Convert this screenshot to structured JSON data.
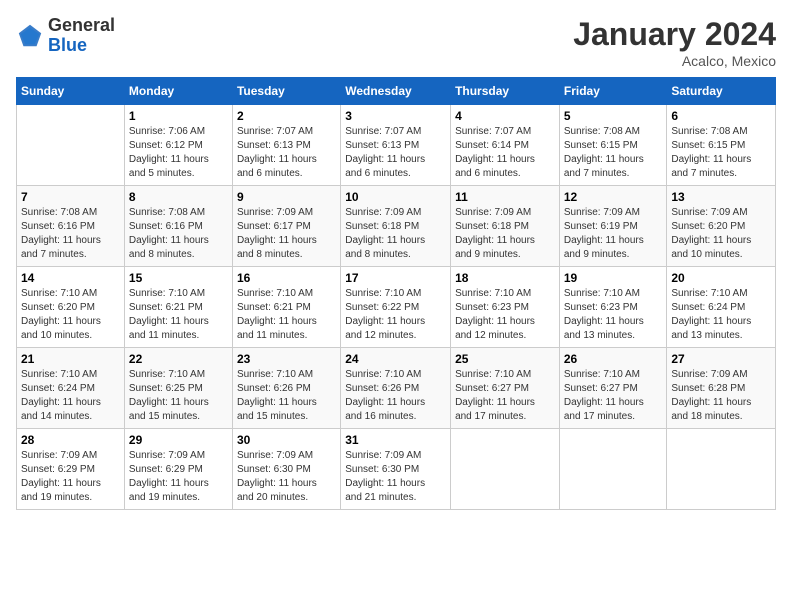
{
  "header": {
    "logo": {
      "line1": "General",
      "line2": "Blue"
    },
    "title": "January 2024",
    "location": "Acalco, Mexico"
  },
  "calendar": {
    "days_of_week": [
      "Sunday",
      "Monday",
      "Tuesday",
      "Wednesday",
      "Thursday",
      "Friday",
      "Saturday"
    ],
    "weeks": [
      [
        {
          "day": "",
          "info": ""
        },
        {
          "day": "1",
          "info": "Sunrise: 7:06 AM\nSunset: 6:12 PM\nDaylight: 11 hours\nand 5 minutes."
        },
        {
          "day": "2",
          "info": "Sunrise: 7:07 AM\nSunset: 6:13 PM\nDaylight: 11 hours\nand 6 minutes."
        },
        {
          "day": "3",
          "info": "Sunrise: 7:07 AM\nSunset: 6:13 PM\nDaylight: 11 hours\nand 6 minutes."
        },
        {
          "day": "4",
          "info": "Sunrise: 7:07 AM\nSunset: 6:14 PM\nDaylight: 11 hours\nand 6 minutes."
        },
        {
          "day": "5",
          "info": "Sunrise: 7:08 AM\nSunset: 6:15 PM\nDaylight: 11 hours\nand 7 minutes."
        },
        {
          "day": "6",
          "info": "Sunrise: 7:08 AM\nSunset: 6:15 PM\nDaylight: 11 hours\nand 7 minutes."
        }
      ],
      [
        {
          "day": "7",
          "info": "Sunrise: 7:08 AM\nSunset: 6:16 PM\nDaylight: 11 hours\nand 7 minutes."
        },
        {
          "day": "8",
          "info": "Sunrise: 7:08 AM\nSunset: 6:16 PM\nDaylight: 11 hours\nand 8 minutes."
        },
        {
          "day": "9",
          "info": "Sunrise: 7:09 AM\nSunset: 6:17 PM\nDaylight: 11 hours\nand 8 minutes."
        },
        {
          "day": "10",
          "info": "Sunrise: 7:09 AM\nSunset: 6:18 PM\nDaylight: 11 hours\nand 8 minutes."
        },
        {
          "day": "11",
          "info": "Sunrise: 7:09 AM\nSunset: 6:18 PM\nDaylight: 11 hours\nand 9 minutes."
        },
        {
          "day": "12",
          "info": "Sunrise: 7:09 AM\nSunset: 6:19 PM\nDaylight: 11 hours\nand 9 minutes."
        },
        {
          "day": "13",
          "info": "Sunrise: 7:09 AM\nSunset: 6:20 PM\nDaylight: 11 hours\nand 10 minutes."
        }
      ],
      [
        {
          "day": "14",
          "info": "Sunrise: 7:10 AM\nSunset: 6:20 PM\nDaylight: 11 hours\nand 10 minutes."
        },
        {
          "day": "15",
          "info": "Sunrise: 7:10 AM\nSunset: 6:21 PM\nDaylight: 11 hours\nand 11 minutes."
        },
        {
          "day": "16",
          "info": "Sunrise: 7:10 AM\nSunset: 6:21 PM\nDaylight: 11 hours\nand 11 minutes."
        },
        {
          "day": "17",
          "info": "Sunrise: 7:10 AM\nSunset: 6:22 PM\nDaylight: 11 hours\nand 12 minutes."
        },
        {
          "day": "18",
          "info": "Sunrise: 7:10 AM\nSunset: 6:23 PM\nDaylight: 11 hours\nand 12 minutes."
        },
        {
          "day": "19",
          "info": "Sunrise: 7:10 AM\nSunset: 6:23 PM\nDaylight: 11 hours\nand 13 minutes."
        },
        {
          "day": "20",
          "info": "Sunrise: 7:10 AM\nSunset: 6:24 PM\nDaylight: 11 hours\nand 13 minutes."
        }
      ],
      [
        {
          "day": "21",
          "info": "Sunrise: 7:10 AM\nSunset: 6:24 PM\nDaylight: 11 hours\nand 14 minutes."
        },
        {
          "day": "22",
          "info": "Sunrise: 7:10 AM\nSunset: 6:25 PM\nDaylight: 11 hours\nand 15 minutes."
        },
        {
          "day": "23",
          "info": "Sunrise: 7:10 AM\nSunset: 6:26 PM\nDaylight: 11 hours\nand 15 minutes."
        },
        {
          "day": "24",
          "info": "Sunrise: 7:10 AM\nSunset: 6:26 PM\nDaylight: 11 hours\nand 16 minutes."
        },
        {
          "day": "25",
          "info": "Sunrise: 7:10 AM\nSunset: 6:27 PM\nDaylight: 11 hours\nand 17 minutes."
        },
        {
          "day": "26",
          "info": "Sunrise: 7:10 AM\nSunset: 6:27 PM\nDaylight: 11 hours\nand 17 minutes."
        },
        {
          "day": "27",
          "info": "Sunrise: 7:09 AM\nSunset: 6:28 PM\nDaylight: 11 hours\nand 18 minutes."
        }
      ],
      [
        {
          "day": "28",
          "info": "Sunrise: 7:09 AM\nSunset: 6:29 PM\nDaylight: 11 hours\nand 19 minutes."
        },
        {
          "day": "29",
          "info": "Sunrise: 7:09 AM\nSunset: 6:29 PM\nDaylight: 11 hours\nand 19 minutes."
        },
        {
          "day": "30",
          "info": "Sunrise: 7:09 AM\nSunset: 6:30 PM\nDaylight: 11 hours\nand 20 minutes."
        },
        {
          "day": "31",
          "info": "Sunrise: 7:09 AM\nSunset: 6:30 PM\nDaylight: 11 hours\nand 21 minutes."
        },
        {
          "day": "",
          "info": ""
        },
        {
          "day": "",
          "info": ""
        },
        {
          "day": "",
          "info": ""
        }
      ]
    ]
  }
}
